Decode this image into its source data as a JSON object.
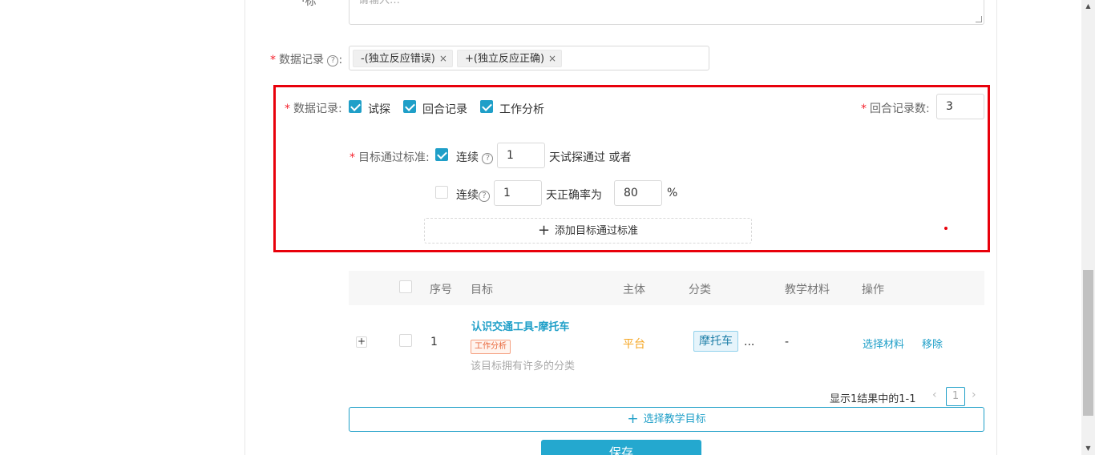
{
  "form": {
    "top_label_partial": "·标",
    "textarea_placeholder_partial": "请输入…",
    "data_record_label": "数据记录",
    "data_record_tags": [
      "-(独立反应错误)",
      "+(独立反应正确)"
    ],
    "tag_close": "×",
    "help_glyph": "?",
    "colon": ":",
    "required_mark": "*"
  },
  "record_panel": {
    "label": "数据记录",
    "options": [
      {
        "label": "试探",
        "checked": true
      },
      {
        "label": "回合记录",
        "checked": true
      },
      {
        "label": "工作分析",
        "checked": true
      }
    ],
    "round_count_label": "回合记录数",
    "round_count_value": "3",
    "criteria_label": "目标通过标准",
    "criteria_1": {
      "checked": true,
      "prefix": "连续",
      "days": "1",
      "suffix": "天试探通过 或者"
    },
    "criteria_2": {
      "checked": false,
      "prefix": "连续",
      "days": "1",
      "mid": "天正确率为",
      "rate": "80",
      "unit": "%"
    },
    "add_criteria_label": "添加目标通过标准",
    "plus": "+"
  },
  "table": {
    "columns": [
      "序号",
      "目标",
      "主体",
      "分类",
      "教学材料",
      "操作"
    ],
    "rows": [
      {
        "index": "1",
        "goal_title": "认识交通工具-摩托车",
        "goal_badge": "工作分析",
        "goal_note": "该目标拥有许多的分类",
        "subject": "平台",
        "category": "摩托车",
        "category_more": "...",
        "material": "-",
        "actions": [
          "选择材料",
          "移除"
        ]
      }
    ],
    "expand_glyph": "+"
  },
  "pagination": {
    "summary": "显示1结果中的1-1",
    "prev": "‹",
    "page": "1",
    "next": "›"
  },
  "buttons": {
    "select_goal": "选择教学目标",
    "save": "保存"
  },
  "scrollbar": {
    "up": "▲",
    "down": "▼"
  }
}
